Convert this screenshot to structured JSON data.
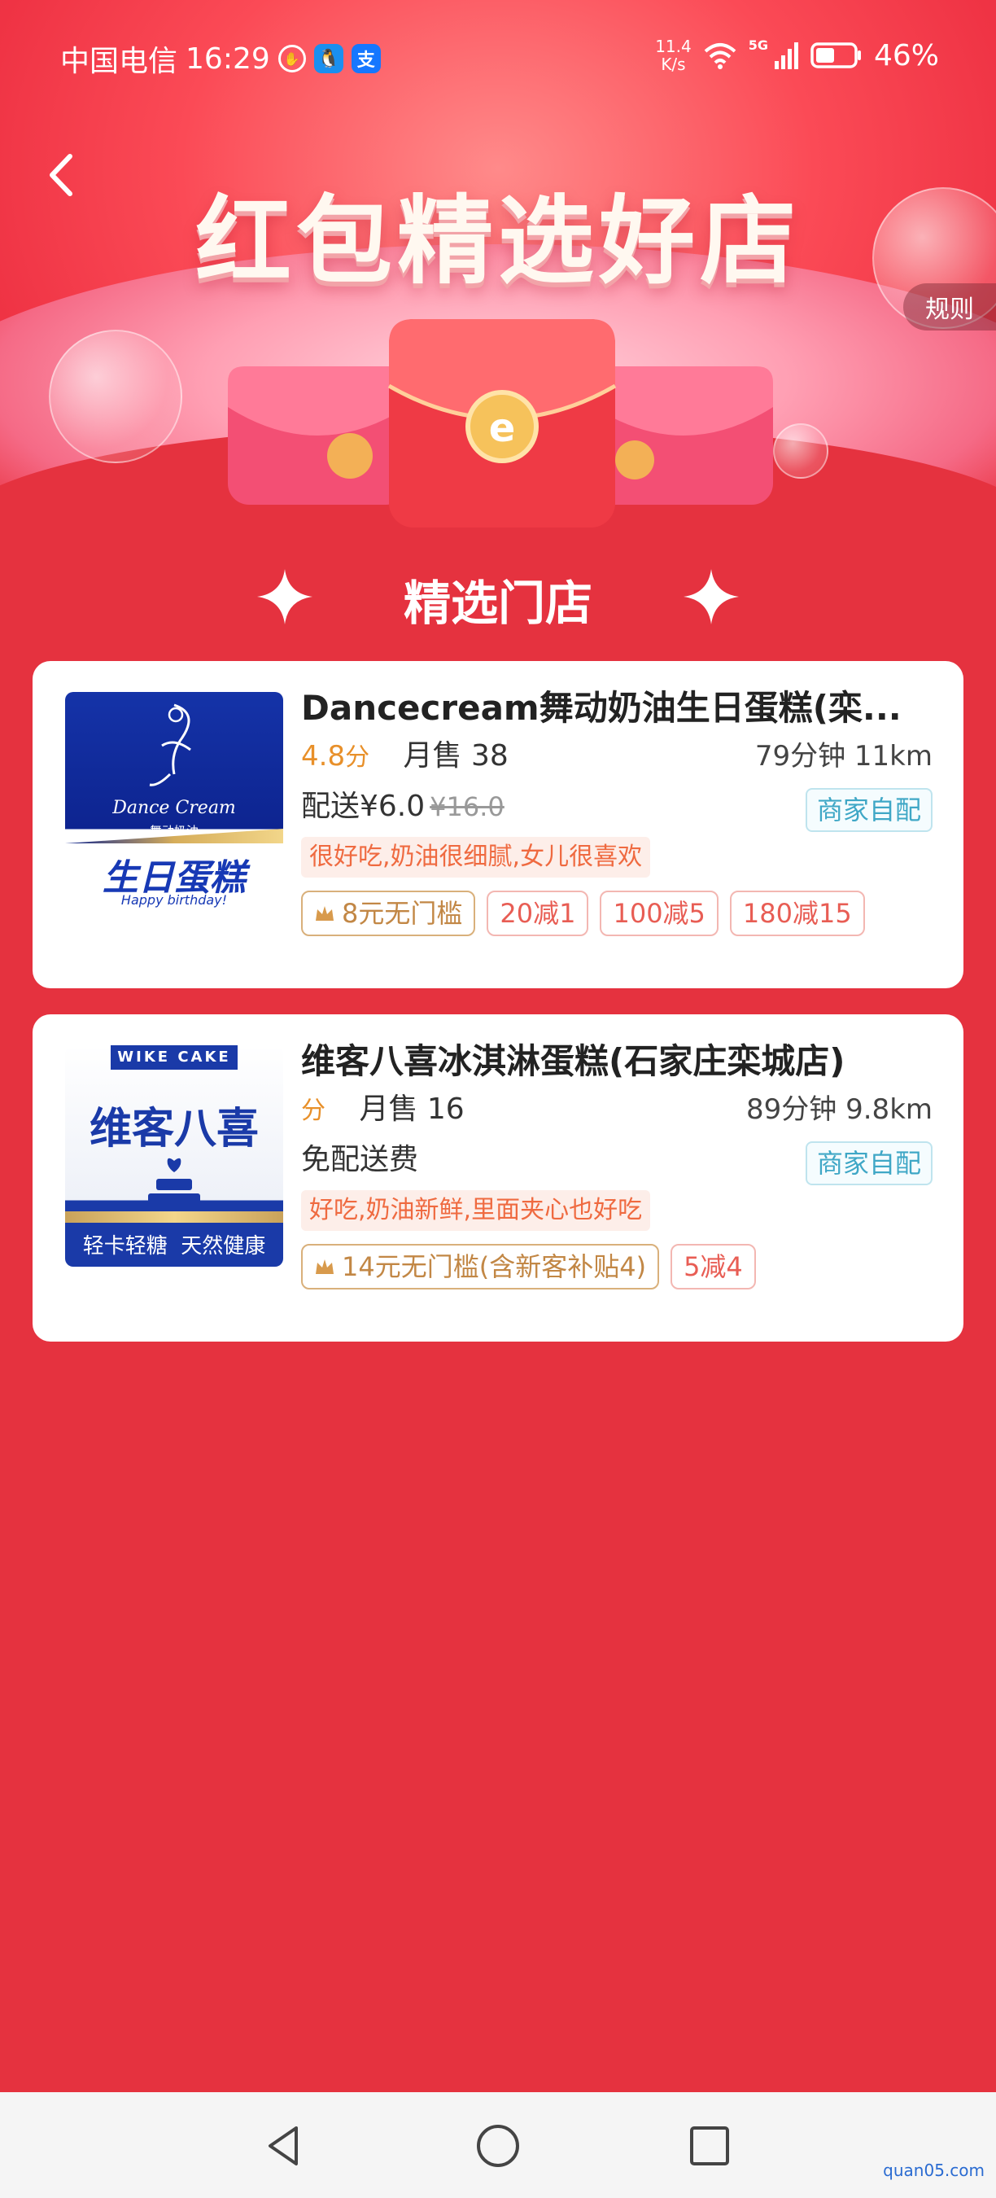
{
  "status_bar": {
    "carrier": "中国电信",
    "time": "16:29",
    "app_icons": [
      "shield-hand-icon",
      "qq-icon",
      "alipay-icon"
    ],
    "alipay_glyph": "支",
    "net_speed_value": "11.4",
    "net_speed_unit": "K/s",
    "network": "5G",
    "battery": "46%"
  },
  "header": {
    "back_icon": "chevron-left-icon",
    "banner_title": "红包精选好店",
    "rules_label": "规则"
  },
  "section": {
    "title": "精选门店"
  },
  "shops": [
    {
      "name": "Dancecream舞动奶油生日蛋糕(栾...",
      "rating": "4.8",
      "rating_unit": "分",
      "monthly_sales": "月售 38",
      "eta_distance": "79分钟  11km",
      "delivery_fee": "配送¥6.0",
      "delivery_fee_original": "¥16.0",
      "delivery_mode": "商家自配",
      "review": "很好吃,奶油很细腻,女儿很喜欢",
      "tags": [
        "8元无门槛",
        "20减1",
        "100减5",
        "180减15"
      ],
      "thumb": {
        "brand": "Dance Cream",
        "brand_cn": "舞动奶油",
        "banner": "生日蛋糕",
        "subtitle": "Happy birthday!"
      }
    },
    {
      "name": "维客八喜冰淇淋蛋糕(石家庄栾城店)",
      "rating": "",
      "rating_unit": "分",
      "monthly_sales": "月售 16",
      "eta_distance": "89分钟  9.8km",
      "delivery_fee": "免配送费",
      "delivery_fee_original": "",
      "delivery_mode": "商家自配",
      "review": "好吃,奶油新鲜,里面夹心也好吃",
      "tags": [
        "14元无门槛(含新客补贴4)",
        "5减4"
      ],
      "thumb": {
        "brand": "WIKE CAKE",
        "brand_cn": "维客八喜",
        "slogan": "轻卡轻糖  天然健康"
      }
    }
  ],
  "nav": {
    "back": "triangle-back-icon",
    "home": "circle-home-icon",
    "recent": "square-recent-icon"
  },
  "watermark": "quan05.com",
  "colors": {
    "page_bg": "#e5323f",
    "rating": "#e8902a",
    "tag_border": "#f3b7b2",
    "gold_tag": "#c28745",
    "self_deliver": "#3fa7c6"
  }
}
